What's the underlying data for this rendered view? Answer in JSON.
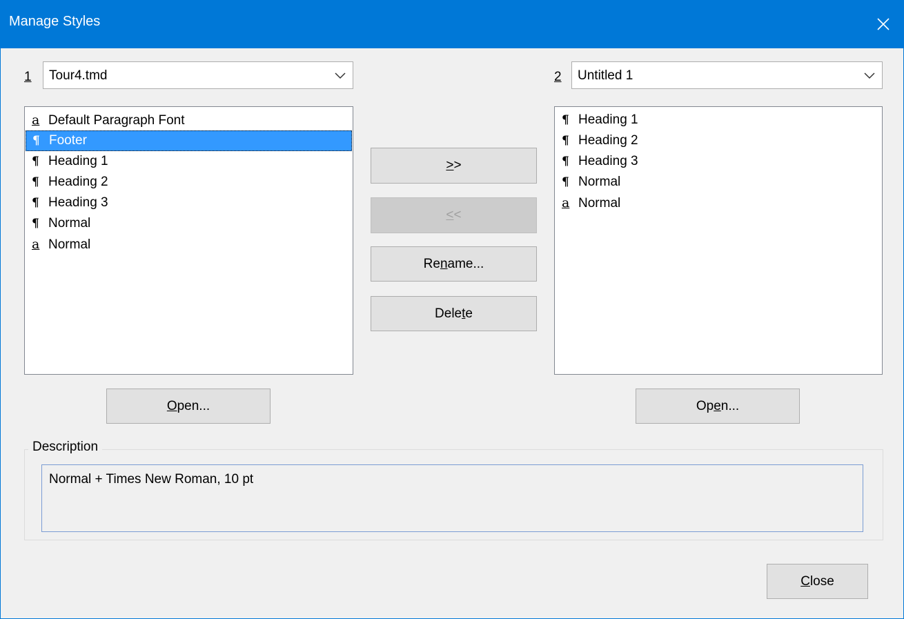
{
  "window": {
    "title": "Manage Styles"
  },
  "left": {
    "number": "1",
    "file": "Tour4.tmd",
    "items": [
      {
        "glyph": "a",
        "label": "Default Paragraph Font"
      },
      {
        "glyph": "¶",
        "label": "Footer",
        "selected": true
      },
      {
        "glyph": "¶",
        "label": "Heading 1"
      },
      {
        "glyph": "¶",
        "label": "Heading 2"
      },
      {
        "glyph": "¶",
        "label": "Heading 3"
      },
      {
        "glyph": "¶",
        "label": "Normal"
      },
      {
        "glyph": "a",
        "label": "Normal"
      }
    ],
    "open_label_pre": "",
    "open_label_u": "O",
    "open_label_post": "pen..."
  },
  "right": {
    "number": "2",
    "file": "Untitled 1",
    "items": [
      {
        "glyph": "¶",
        "label": "Heading 1"
      },
      {
        "glyph": "¶",
        "label": "Heading 2"
      },
      {
        "glyph": "¶",
        "label": "Heading 3"
      },
      {
        "glyph": "¶",
        "label": "Normal"
      },
      {
        "glyph": "a",
        "label": "Normal"
      }
    ],
    "open_label_pre": "Op",
    "open_label_u": "e",
    "open_label_post": "n..."
  },
  "middle": {
    "copy_right": {
      "u": ">",
      "rest": ">"
    },
    "copy_left": {
      "u": "<",
      "rest": "<"
    },
    "rename": {
      "pre": "Re",
      "u": "n",
      "post": "ame..."
    },
    "delete": {
      "pre": "Dele",
      "u": "t",
      "post": "e"
    }
  },
  "description": {
    "label": "Description",
    "text": "Normal + Times New Roman, 10 pt"
  },
  "close": {
    "u": "C",
    "post": "lose"
  },
  "colors": {
    "accent": "#0078d7",
    "selection": "#3399ff"
  }
}
